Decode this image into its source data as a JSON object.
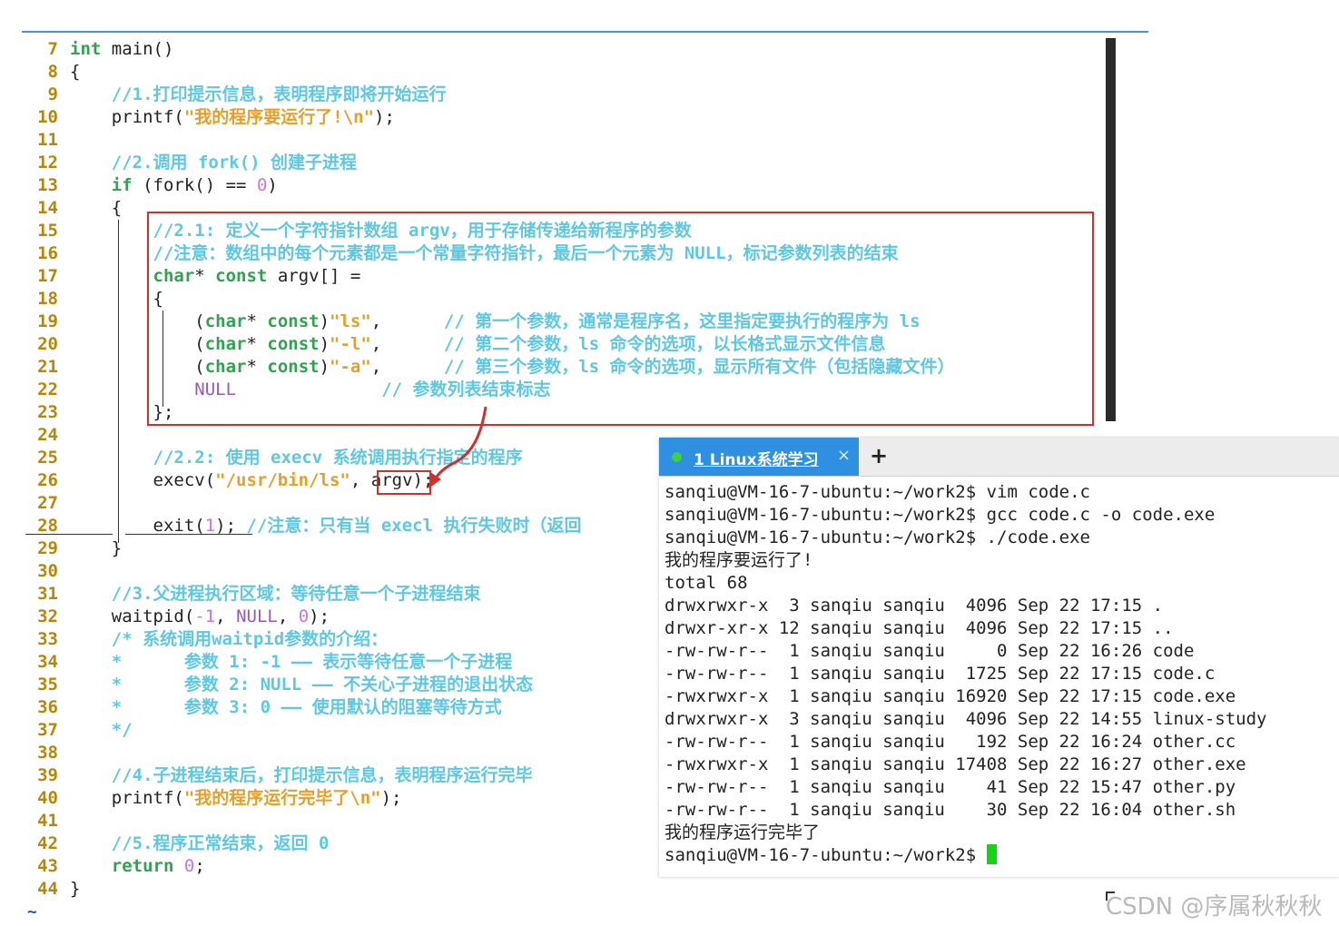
{
  "editor": {
    "lines": [
      {
        "num": "7",
        "segs": [
          [
            "kw",
            "int"
          ],
          [
            "df",
            " main()"
          ]
        ]
      },
      {
        "num": "8",
        "segs": [
          [
            "df",
            "{"
          ]
        ]
      },
      {
        "num": "9",
        "segs": [
          [
            "df",
            "    "
          ],
          [
            "cm",
            "//1.打印提示信息，表明程序即将开始运行"
          ]
        ]
      },
      {
        "num": "10",
        "segs": [
          [
            "df",
            "    printf("
          ],
          [
            "st",
            "\"我的程序要运行了!\\n\""
          ],
          [
            "df",
            ");"
          ]
        ]
      },
      {
        "num": "11",
        "segs": []
      },
      {
        "num": "12",
        "segs": [
          [
            "df",
            "    "
          ],
          [
            "cm",
            "//2.调用 fork() 创建子进程"
          ]
        ]
      },
      {
        "num": "13",
        "segs": [
          [
            "df",
            "    "
          ],
          [
            "kw",
            "if"
          ],
          [
            "df",
            " (fork() == "
          ],
          [
            "nm",
            "0"
          ],
          [
            "df",
            ")"
          ]
        ]
      },
      {
        "num": "14",
        "segs": [
          [
            "df",
            "    {"
          ]
        ]
      },
      {
        "num": "15",
        "segs": [
          [
            "df",
            "        "
          ],
          [
            "cm",
            "//2.1: 定义一个字符指针数组 argv，用于存储传递给新程序的参数"
          ]
        ]
      },
      {
        "num": "16",
        "segs": [
          [
            "df",
            "        "
          ],
          [
            "cm",
            "//注意：数组中的每个元素都是一个常量字符指针，最后一个元素为 NULL，标记参数列表的结束"
          ]
        ]
      },
      {
        "num": "17",
        "segs": [
          [
            "df",
            "        "
          ],
          [
            "kw",
            "char"
          ],
          [
            "df",
            "* "
          ],
          [
            "kw",
            "const"
          ],
          [
            "df",
            " argv[] ="
          ]
        ]
      },
      {
        "num": "18",
        "segs": [
          [
            "df",
            "        {"
          ]
        ]
      },
      {
        "num": "19",
        "segs": [
          [
            "df",
            "            ("
          ],
          [
            "kw",
            "char"
          ],
          [
            "df",
            "* "
          ],
          [
            "kw",
            "const"
          ],
          [
            "df",
            ")"
          ],
          [
            "st",
            "\"ls\""
          ],
          [
            "df",
            ",      "
          ],
          [
            "cm",
            "// 第一个参数，通常是程序名，这里指定要执行的程序为 ls"
          ]
        ]
      },
      {
        "num": "20",
        "segs": [
          [
            "df",
            "            ("
          ],
          [
            "kw",
            "char"
          ],
          [
            "df",
            "* "
          ],
          [
            "kw",
            "const"
          ],
          [
            "df",
            ")"
          ],
          [
            "st",
            "\"-l\""
          ],
          [
            "df",
            ",      "
          ],
          [
            "cm",
            "// 第二个参数，ls 命令的选项，以长格式显示文件信息"
          ]
        ]
      },
      {
        "num": "21",
        "segs": [
          [
            "df",
            "            ("
          ],
          [
            "kw",
            "char"
          ],
          [
            "df",
            "* "
          ],
          [
            "kw",
            "const"
          ],
          [
            "df",
            ")"
          ],
          [
            "st",
            "\"-a\""
          ],
          [
            "df",
            ",      "
          ],
          [
            "cm",
            "// 第三个参数，ls 命令的选项，显示所有文件（包括隐藏文件）"
          ]
        ]
      },
      {
        "num": "22",
        "segs": [
          [
            "df",
            "            "
          ],
          [
            "nul",
            "NULL"
          ],
          [
            "df",
            "              "
          ],
          [
            "cm",
            "// 参数列表结束标志"
          ]
        ]
      },
      {
        "num": "23",
        "segs": [
          [
            "df",
            "        };"
          ]
        ]
      },
      {
        "num": "24",
        "segs": []
      },
      {
        "num": "25",
        "segs": [
          [
            "df",
            "        "
          ],
          [
            "cm",
            "//2.2: 使用 execv 系统调用执行指定的程序"
          ]
        ]
      },
      {
        "num": "26",
        "segs": [
          [
            "df",
            "        execv("
          ],
          [
            "st",
            "\"/usr/bin/ls\""
          ],
          [
            "df",
            ", argv);"
          ]
        ]
      },
      {
        "num": "27",
        "segs": []
      },
      {
        "num": "28",
        "segs": [
          [
            "df",
            "        exit("
          ],
          [
            "nm",
            "1"
          ],
          [
            "df",
            "); "
          ],
          [
            "cm",
            "//注意：只有当 execl 执行失败时（返回"
          ]
        ]
      },
      {
        "num": "29",
        "segs": [
          [
            "df",
            "    }"
          ]
        ]
      },
      {
        "num": "30",
        "segs": []
      },
      {
        "num": "31",
        "segs": [
          [
            "df",
            "    "
          ],
          [
            "cm",
            "//3.父进程执行区域：等待任意一个子进程结束"
          ]
        ]
      },
      {
        "num": "32",
        "segs": [
          [
            "df",
            "    waitpid("
          ],
          [
            "nm",
            "-1"
          ],
          [
            "df",
            ", "
          ],
          [
            "nul",
            "NULL"
          ],
          [
            "df",
            ", "
          ],
          [
            "nm",
            "0"
          ],
          [
            "df",
            ");"
          ]
        ]
      },
      {
        "num": "33",
        "segs": [
          [
            "df",
            "    "
          ],
          [
            "cm",
            "/* 系统调用waitpid参数的介绍："
          ]
        ]
      },
      {
        "num": "34",
        "segs": [
          [
            "df",
            "    "
          ],
          [
            "cm",
            "*      参数 1: -1 —— 表示等待任意一个子进程"
          ]
        ]
      },
      {
        "num": "35",
        "segs": [
          [
            "df",
            "    "
          ],
          [
            "cm",
            "*      参数 2: NULL —— 不关心子进程的退出状态"
          ]
        ]
      },
      {
        "num": "36",
        "segs": [
          [
            "df",
            "    "
          ],
          [
            "cm",
            "*      参数 3: 0 —— 使用默认的阻塞等待方式"
          ]
        ]
      },
      {
        "num": "37",
        "segs": [
          [
            "df",
            "    "
          ],
          [
            "cm",
            "*/"
          ]
        ]
      },
      {
        "num": "38",
        "segs": []
      },
      {
        "num": "39",
        "segs": [
          [
            "df",
            "    "
          ],
          [
            "cm",
            "//4.子进程结束后，打印提示信息，表明程序运行完毕"
          ]
        ]
      },
      {
        "num": "40",
        "segs": [
          [
            "df",
            "    printf("
          ],
          [
            "st",
            "\"我的程序运行完毕了\\n\""
          ],
          [
            "df",
            ");"
          ]
        ]
      },
      {
        "num": "41",
        "segs": []
      },
      {
        "num": "42",
        "segs": [
          [
            "df",
            "    "
          ],
          [
            "cm",
            "//5.程序正常结束，返回 0"
          ]
        ]
      },
      {
        "num": "43",
        "segs": [
          [
            "df",
            "    "
          ],
          [
            "kw",
            "return"
          ],
          [
            "df",
            " "
          ],
          [
            "nm",
            "0"
          ],
          [
            "df",
            ";"
          ]
        ]
      },
      {
        "num": "44",
        "segs": [
          [
            "df",
            "}"
          ]
        ]
      }
    ],
    "tilde": "~"
  },
  "terminal": {
    "tab_label": "1 Linux系统学习",
    "tab_close": "×",
    "new_tab": "+",
    "lines": [
      "sanqiu@VM-16-7-ubuntu:~/work2$ vim code.c",
      "sanqiu@VM-16-7-ubuntu:~/work2$ gcc code.c -o code.exe",
      "sanqiu@VM-16-7-ubuntu:~/work2$ ./code.exe",
      "我的程序要运行了!",
      "total 68",
      "drwxrwxr-x  3 sanqiu sanqiu  4096 Sep 22 17:15 .",
      "drwxr-xr-x 12 sanqiu sanqiu  4096 Sep 22 17:15 ..",
      "-rw-rw-r--  1 sanqiu sanqiu     0 Sep 22 16:26 code",
      "-rw-rw-r--  1 sanqiu sanqiu  1725 Sep 22 17:15 code.c",
      "-rwxrwxr-x  1 sanqiu sanqiu 16920 Sep 22 17:15 code.exe",
      "drwxrwxr-x  3 sanqiu sanqiu  4096 Sep 22 14:55 linux-study",
      "-rw-rw-r--  1 sanqiu sanqiu   192 Sep 22 16:24 other.cc",
      "-rwxrwxr-x  1 sanqiu sanqiu 17408 Sep 22 16:27 other.exe",
      "-rw-rw-r--  1 sanqiu sanqiu    41 Sep 22 15:47 other.py",
      "-rw-rw-r--  1 sanqiu sanqiu    30 Sep 22 16:04 other.sh",
      "我的程序运行完毕了"
    ],
    "prompt": "sanqiu@VM-16-7-ubuntu:~/work2$ "
  },
  "watermark": "CSDN @序属秋秋秋",
  "colors": {
    "keyword": "#2ea44f",
    "comment": "#5fc8e0",
    "string": "#e5a02a",
    "line_number": "#b8860b",
    "highlight_box": "#d0312d",
    "tab_active": "#2f8fe0",
    "cursor": "#12d612"
  }
}
